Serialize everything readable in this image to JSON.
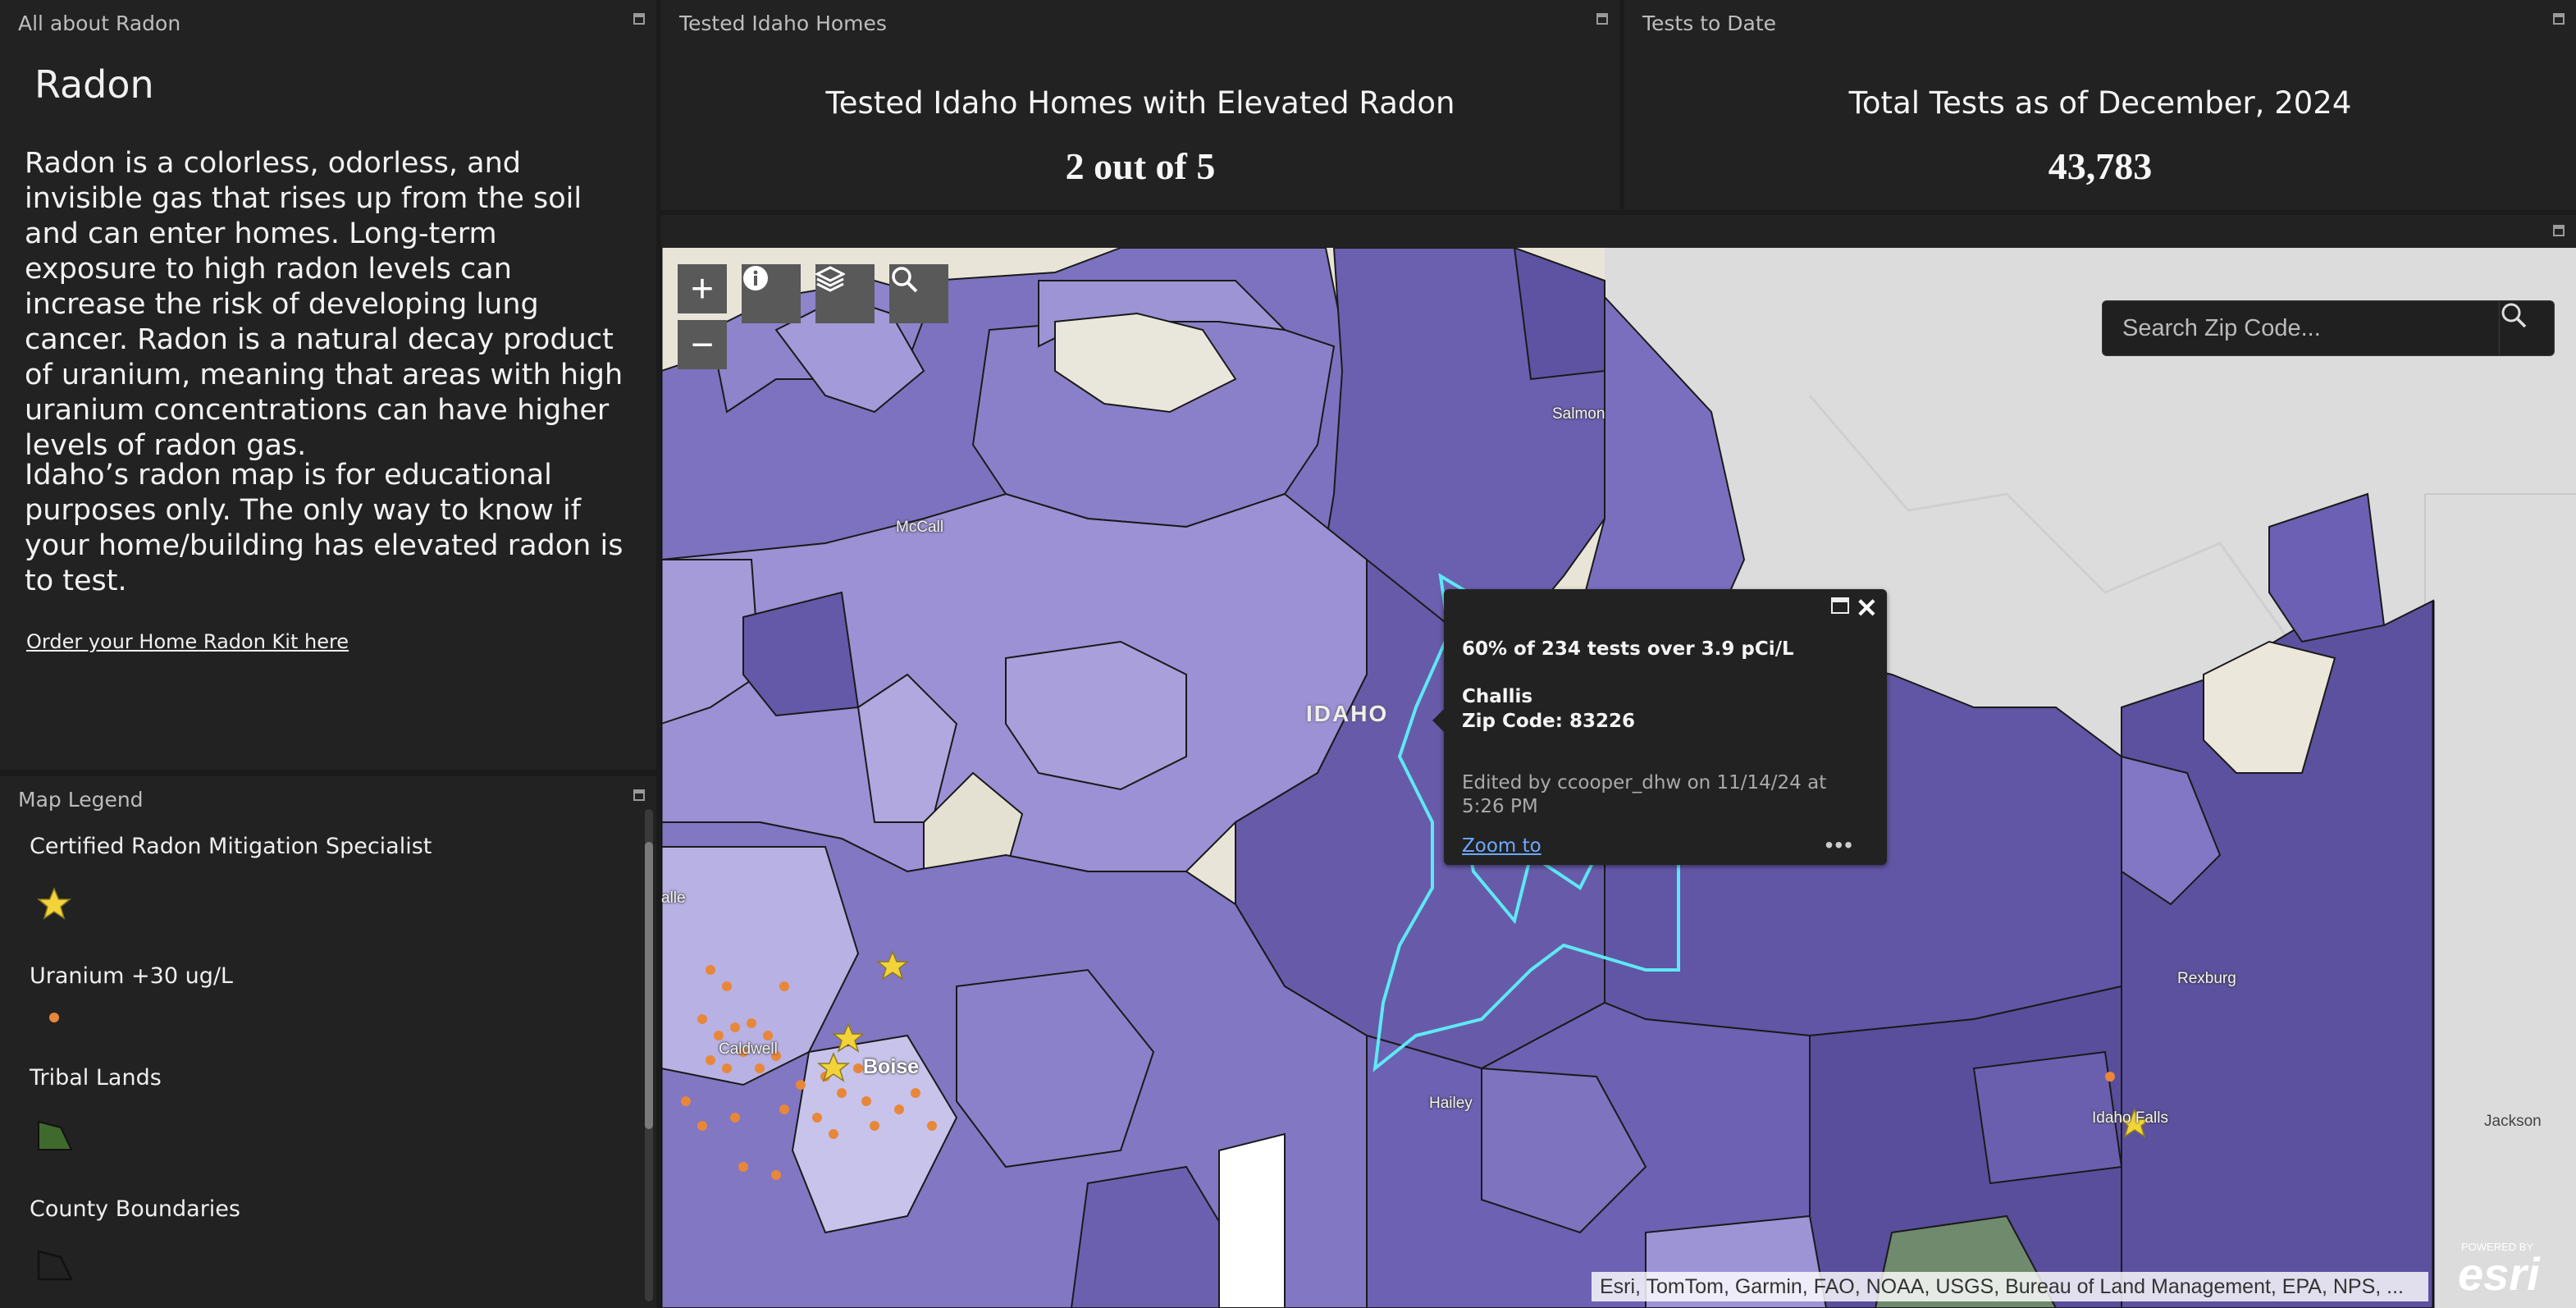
{
  "about": {
    "panel_title": "All about Radon",
    "heading": "Radon",
    "paragraph1": "Radon is a colorless, odorless, and invisible gas that rises up from the soil and can enter homes. Long-term exposure to high radon levels can increase the risk of developing lung cancer. Radon is a natural decay product of uranium, meaning that areas with high uranium concentrations can have higher levels of radon gas.",
    "paragraph2": "Idaho’s radon map is for educational purposes only. The only way to know if your home/building has elevated radon is to test.",
    "order_link": "Order your Home Radon Kit here"
  },
  "legend": {
    "panel_title": "Map Legend",
    "items": [
      {
        "label": "Certified Radon Mitigation Specialist",
        "icon": "star-icon",
        "color": "#f2d33a"
      },
      {
        "label": "Uranium +30 ug/L",
        "icon": "dot-icon",
        "color": "#e8873a"
      },
      {
        "label": "Tribal Lands",
        "icon": "polygon-icon",
        "color": "#3f6a2e"
      },
      {
        "label": "County Boundaries",
        "icon": "polygon-outline-icon",
        "color": "#111111"
      }
    ]
  },
  "indicator1": {
    "panel_title": "Tested Idaho Homes",
    "title": "Tested Idaho Homes with Elevated Radon",
    "value": "2 out of 5"
  },
  "indicator2": {
    "panel_title": "Tests to Date",
    "title": "Total Tests as of December, 2024",
    "value": "43,783"
  },
  "map": {
    "search_placeholder": "Search Zip Code...",
    "zoom_in": "+",
    "zoom_out": "−",
    "places": {
      "salmon": "Salmon",
      "mccall": "McCall",
      "idaho": "IDAHO",
      "caldwell": "Caldwell",
      "boise": "Boise",
      "hailey": "Hailey",
      "rexburg": "Rexburg",
      "idaho_falls": "Idaho Falls",
      "jackson": "Jackson",
      "nampa_partial": "alle"
    },
    "attribution": "Esri, TomTom, Garmin, FAO, NOAA, USGS, Bureau of Land Management, EPA, NPS, ...",
    "powered_by": "POWERED BY",
    "esri": "esri",
    "highlight_color": "#5ee8f5"
  },
  "popup": {
    "stat": "60% of 234 tests over 3.9 pCi/L",
    "place": "Challis",
    "zip": "Zip Code: 83226",
    "edited": "Edited by ccooper_dhw on 11/14/24 at 5:26 PM",
    "zoom_link": "Zoom to",
    "more": "•••"
  }
}
